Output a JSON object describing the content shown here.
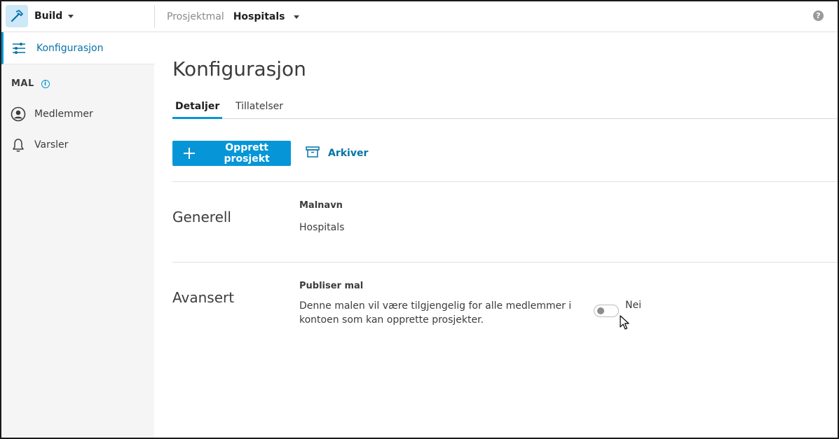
{
  "app": {
    "name": "Build"
  },
  "breadcrumb": {
    "label": "Prosjektmal",
    "project": "Hospitals"
  },
  "sidebar": {
    "active_item": "Konfigurasjon",
    "section_title": "MAL",
    "items": [
      {
        "label": "Medlemmer",
        "icon": "user-circle-icon"
      },
      {
        "label": "Varsler",
        "icon": "bell-icon"
      }
    ]
  },
  "main": {
    "title": "Konfigurasjon",
    "tabs": [
      {
        "label": "Detaljer",
        "active": true
      },
      {
        "label": "Tillatelser",
        "active": false
      }
    ],
    "create_button": "Opprett prosjekt",
    "archive_button": "Arkiver",
    "general": {
      "heading": "Generell",
      "field_label": "Malnavn",
      "field_value": "Hospitals"
    },
    "advanced": {
      "heading": "Avansert",
      "field_label": "Publiser mal",
      "description": "Denne malen vil være tilgjengelig for alle medlemmer i kontoen som kan opprette prosjekter.",
      "toggle_value": "Nei",
      "toggle_on": false
    }
  },
  "colors": {
    "accent": "#0696d7",
    "sidebar_bg": "#f5f5f5",
    "logo_bg": "#cde8f6"
  }
}
